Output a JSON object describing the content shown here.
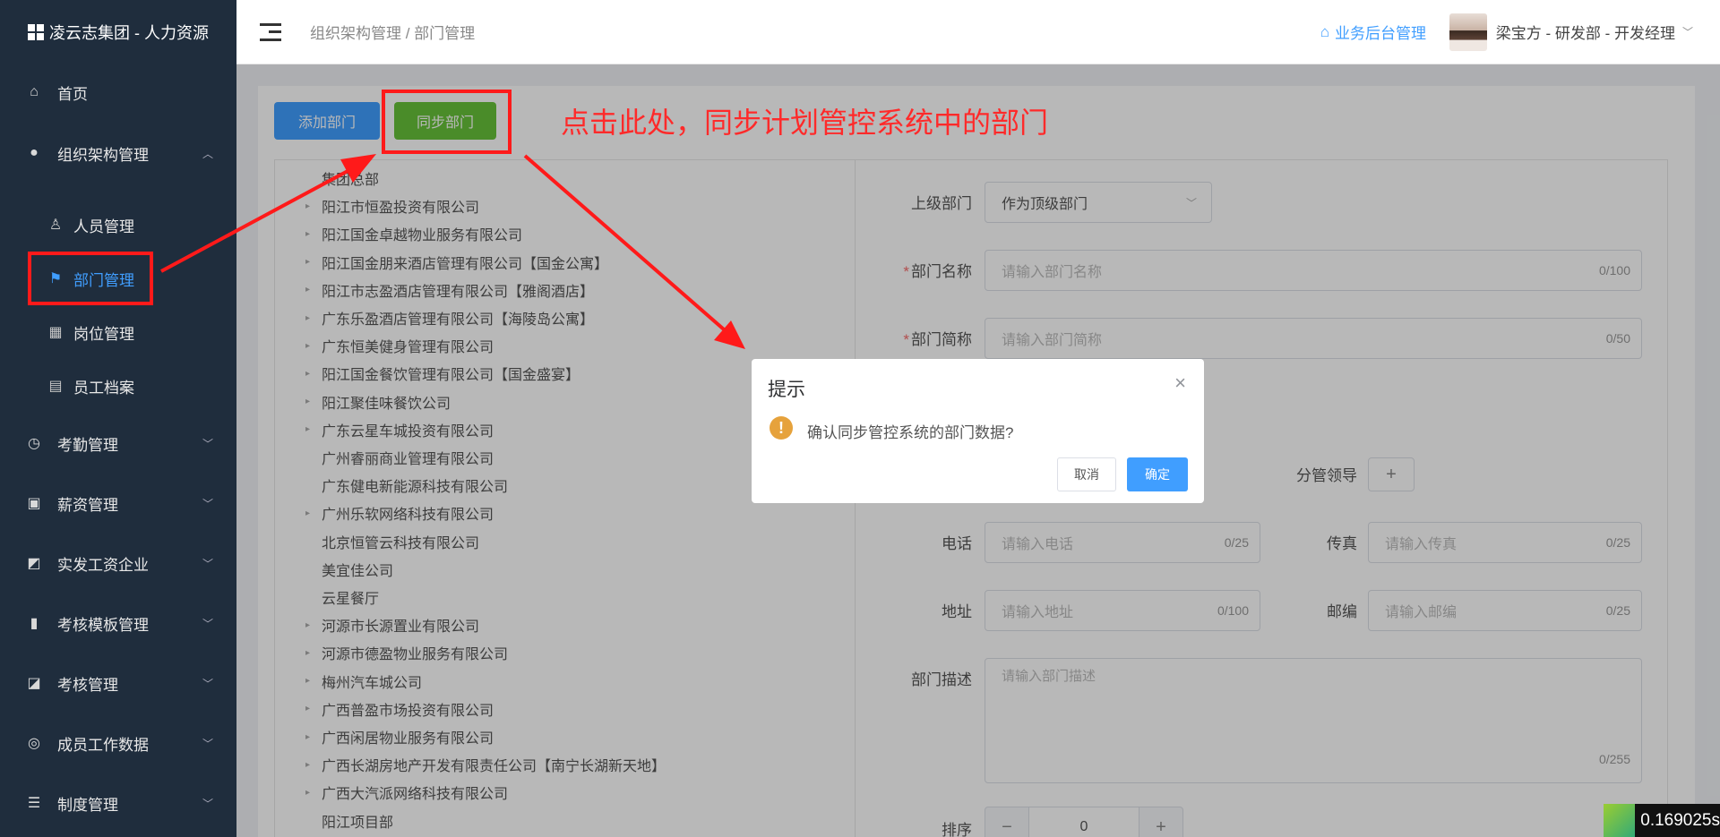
{
  "app": {
    "logo_text": "凌云志集团 - 人力资源"
  },
  "sidebar": {
    "items": [
      {
        "label": "首页",
        "icon": "home-icon"
      },
      {
        "label": "组织架构管理",
        "icon": "user-icon"
      },
      {
        "label": "考勤管理",
        "icon": "clock-icon"
      },
      {
        "label": "薪资管理",
        "icon": "wallet-icon"
      },
      {
        "label": "实发工资企业",
        "icon": "chart-icon"
      },
      {
        "label": "考核模板管理",
        "icon": "book-icon"
      },
      {
        "label": "考核管理",
        "icon": "trend-icon"
      },
      {
        "label": "成员工作数据",
        "icon": "lifebuoy-icon"
      },
      {
        "label": "制度管理",
        "icon": "stack-icon"
      }
    ],
    "subitems": [
      {
        "label": "人员管理",
        "icon": "person-icon"
      },
      {
        "label": "部门管理",
        "icon": "flag-icon"
      },
      {
        "label": "岗位管理",
        "icon": "grid-icon"
      },
      {
        "label": "员工档案",
        "icon": "clipboard-icon"
      }
    ]
  },
  "header": {
    "breadcrumb": "组织架构管理 / 部门管理",
    "biz_link": "业务后台管理",
    "user": "梁宝方 - 研发部 - 开发经理"
  },
  "toolbar": {
    "add_label": "添加部门",
    "sync_label": "同步部门"
  },
  "tree": [
    "集团总部",
    "阳江市恒盈投资有限公司",
    "阳江国金卓越物业服务有限公司",
    "阳江国金朋来酒店管理有限公司【国金公寓】",
    "阳江市志盈酒店管理有限公司【雅阁酒店】",
    "广东乐盈酒店管理有限公司【海陵岛公寓】",
    "广东恒美健身管理有限公司",
    "阳江国金餐饮管理有限公司【国金盛宴】",
    "阳江聚佳味餐饮公司",
    "广东云星车城投资有限公司",
    "广州睿丽商业管理有限公司",
    "广东健电新能源科技有限公司",
    "广州乐软网络科技有限公司",
    "北京恒管云科技有限公司",
    "美宜佳公司",
    "云星餐厅",
    "河源市长源置业有限公司",
    "河源市德盈物业服务有限公司",
    "梅州汽车城公司",
    "广西普盈市场投资有限公司",
    "广西闲居物业服务有限公司",
    "广西长湖房地产开发有限责任公司【南宁长湖新天地】",
    "广西大汽派网络科技有限公司",
    "阳江项目部"
  ],
  "form": {
    "parent_label": "上级部门",
    "parent_value": "作为顶级部门",
    "name_label": "部门名称",
    "name_placeholder": "请输入部门名称",
    "name_count": "0/100",
    "short_label": "部门简称",
    "short_placeholder": "请输入部门简称",
    "short_count": "0/50",
    "leader_label": "分管领导",
    "leader_btn": "+",
    "phone_label": "电话",
    "phone_placeholder": "请输入电话",
    "phone_count": "0/25",
    "fax_label": "传真",
    "fax_placeholder": "请输入传真",
    "fax_count": "0/25",
    "address_label": "地址",
    "address_placeholder": "请输入地址",
    "address_count": "0/100",
    "zip_label": "邮编",
    "zip_placeholder": "请输入邮编",
    "zip_count": "0/25",
    "desc_label": "部门描述",
    "desc_placeholder": "请输入部门描述",
    "desc_count": "0/255",
    "sort_label": "排序",
    "sort_value": "0"
  },
  "dialog": {
    "title": "提示",
    "message": "确认同步管控系统的部门数据?",
    "cancel": "取消",
    "ok": "确定"
  },
  "annotation": "点击此处，同步计划管控系统中的部门",
  "timer": "0.169025s",
  "colors": {
    "primary": "#409eff",
    "success": "#67c23a",
    "sidebar": "#1f2d3d",
    "annotation": "#ff1a1a",
    "warning": "#e6a23c"
  }
}
